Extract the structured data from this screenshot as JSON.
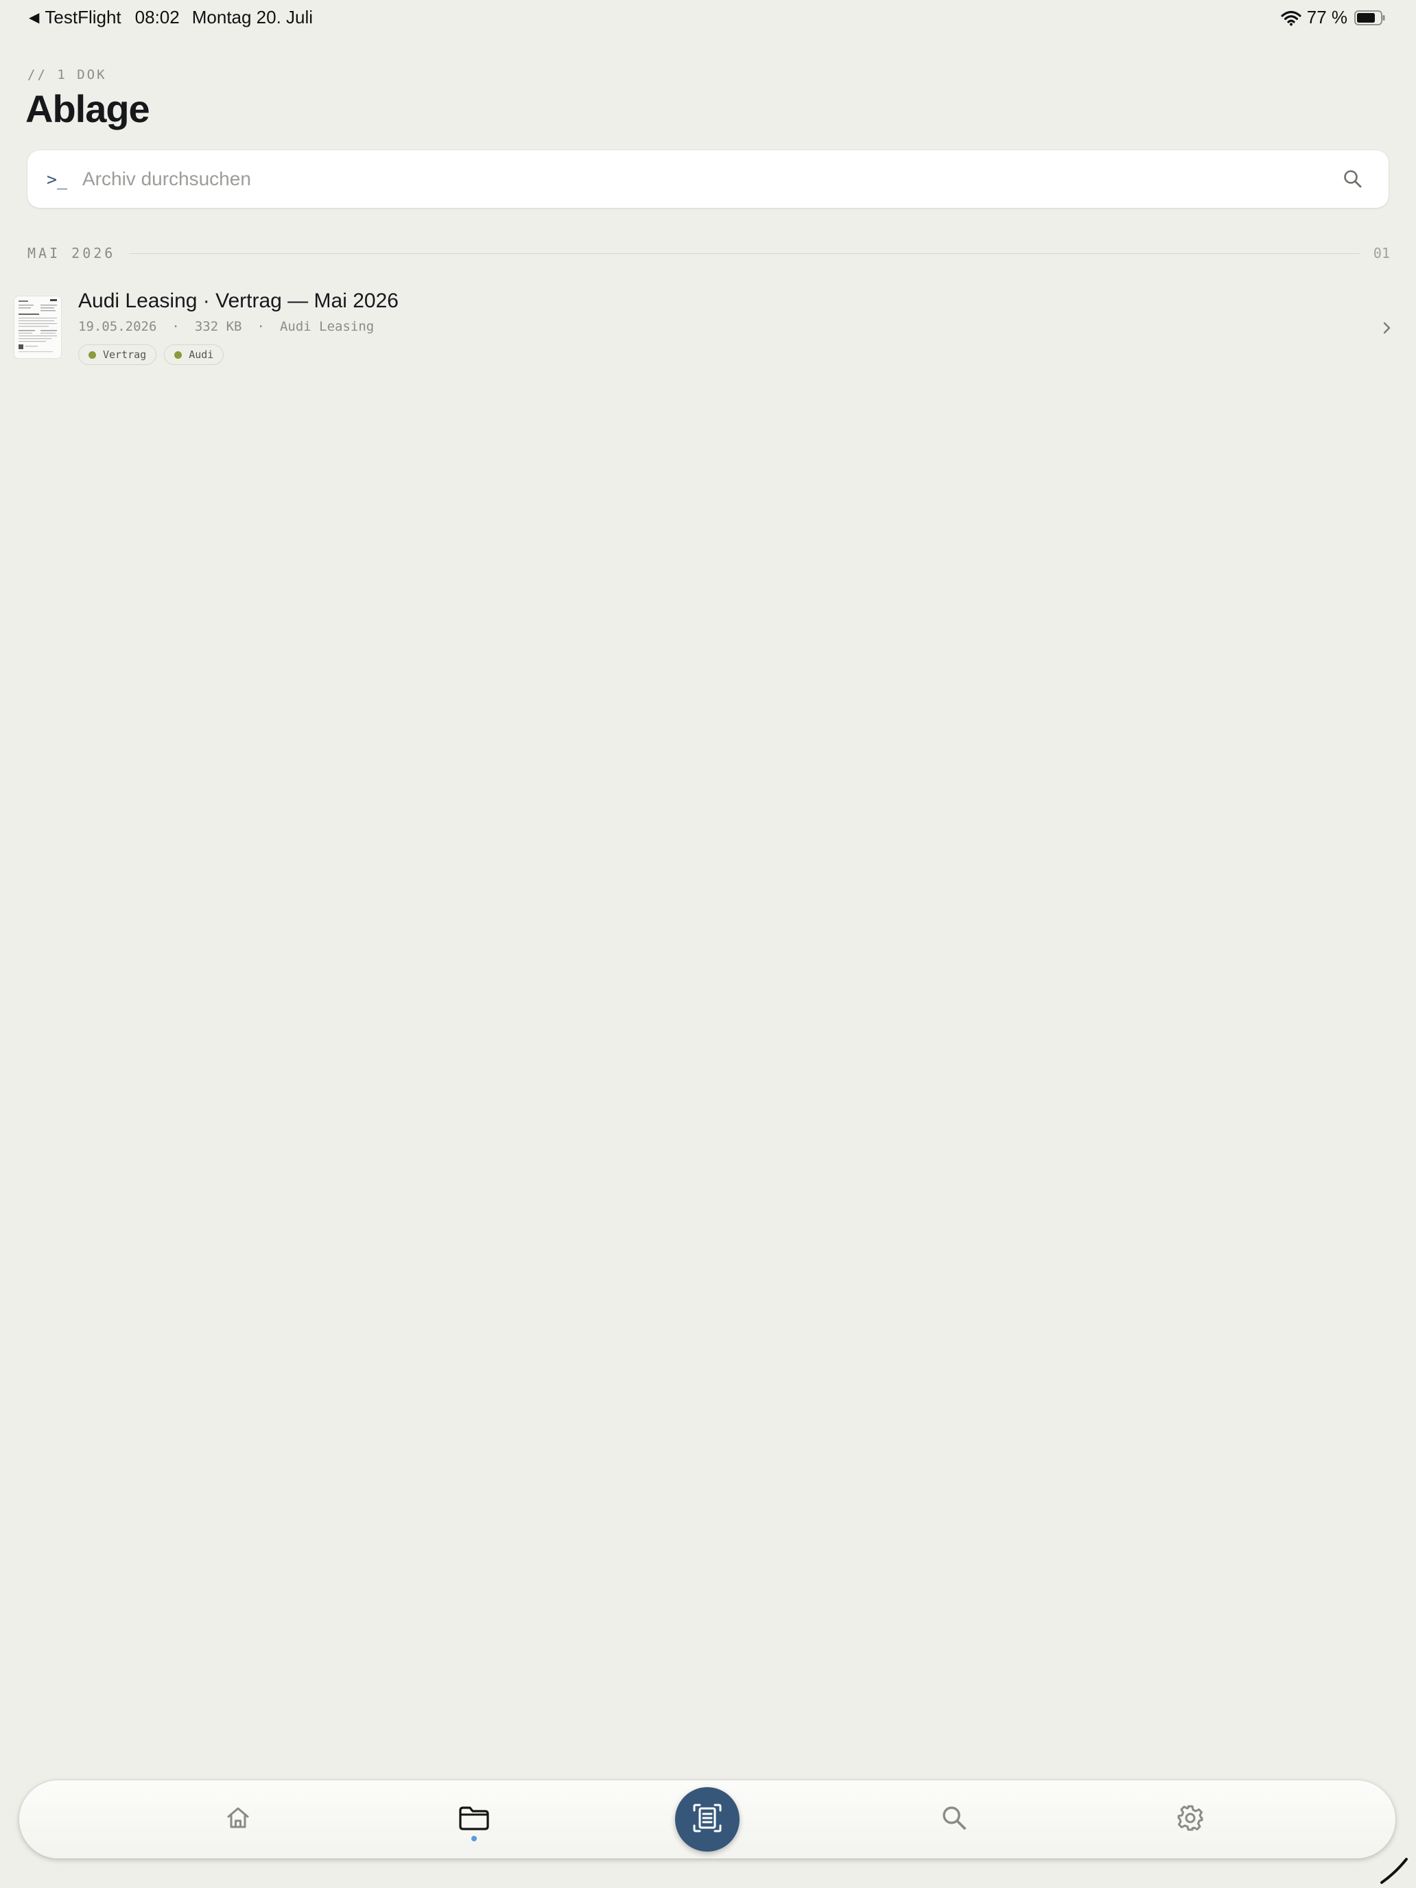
{
  "status_bar": {
    "back_app": "TestFlight",
    "time": "08:02",
    "date": "Montag 20. Juli",
    "battery": "77 %",
    "icons": [
      "back-arrow-icon",
      "wifi-icon",
      "battery-icon"
    ]
  },
  "header": {
    "count": "// 1 DOK",
    "title": "Ablage"
  },
  "search": {
    "prompt_glyph": ">_",
    "placeholder": "Archiv durchsuchen",
    "value": "",
    "icon": "search-icon"
  },
  "sections": [
    {
      "title": "MAI 2026",
      "count": "01",
      "documents": [
        {
          "title": "Audi Leasing · Vertrag — Mai 2026",
          "date": "19.05.2026",
          "size": "332 KB",
          "source": "Audi Leasing",
          "separator": "·",
          "tags": [
            {
              "label": "Vertrag",
              "color": "#8a9a3c"
            },
            {
              "label": "Audi",
              "color": "#8a9a3c"
            }
          ]
        }
      ]
    }
  ],
  "tab_bar": {
    "items": [
      {
        "id": "home",
        "icon": "home-icon",
        "active": false
      },
      {
        "id": "archive",
        "icon": "folder-icon",
        "active": true
      },
      {
        "id": "scan",
        "icon": "scan-document-icon",
        "active": false
      },
      {
        "id": "search",
        "icon": "search-icon",
        "active": false
      },
      {
        "id": "settings",
        "icon": "gear-icon",
        "active": false
      }
    ]
  },
  "colors": {
    "background": "#efefea",
    "accent": "#36577a",
    "active_dot": "#5a9be0",
    "tag_dot": "#8a9a3c"
  }
}
